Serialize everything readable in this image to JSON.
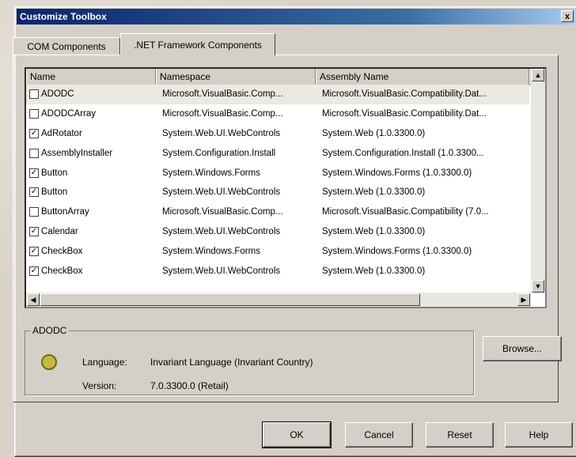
{
  "window": {
    "title": "Customize Toolbox",
    "close": "x"
  },
  "tabs": [
    {
      "label": "COM Components"
    },
    {
      "label": ".NET Framework Components"
    }
  ],
  "list": {
    "columns": [
      "Name",
      "Namespace",
      "Assembly Name"
    ],
    "rows": [
      {
        "checked": false,
        "name": "ADODC",
        "namespace": "Microsoft.VisualBasic.Comp...",
        "assembly": "Microsoft.VisualBasic.Compatibility.Dat..."
      },
      {
        "checked": false,
        "name": "ADODCArray",
        "namespace": "Microsoft.VisualBasic.Comp...",
        "assembly": "Microsoft.VisualBasic.Compatibility.Dat..."
      },
      {
        "checked": true,
        "name": "AdRotator",
        "namespace": "System.Web.UI.WebControls",
        "assembly": "System.Web (1.0.3300.0)"
      },
      {
        "checked": false,
        "name": "AssemblyInstaller",
        "namespace": "System.Configuration.Install",
        "assembly": "System.Configuration.Install (1.0.3300..."
      },
      {
        "checked": true,
        "name": "Button",
        "namespace": "System.Windows.Forms",
        "assembly": "System.Windows.Forms (1.0.3300.0)"
      },
      {
        "checked": true,
        "name": "Button",
        "namespace": "System.Web.UI.WebControls",
        "assembly": "System.Web (1.0.3300.0)"
      },
      {
        "checked": false,
        "name": "ButtonArray",
        "namespace": "Microsoft.VisualBasic.Comp...",
        "assembly": "Microsoft.VisualBasic.Compatibility (7.0..."
      },
      {
        "checked": true,
        "name": "Calendar",
        "namespace": "System.Web.UI.WebControls",
        "assembly": "System.Web (1.0.3300.0)"
      },
      {
        "checked": true,
        "name": "CheckBox",
        "namespace": "System.Windows.Forms",
        "assembly": "System.Windows.Forms (1.0.3300.0)"
      },
      {
        "checked": true,
        "name": "CheckBox",
        "namespace": "System.Web.UI.WebControls",
        "assembly": "System.Web (1.0.3300.0)"
      }
    ]
  },
  "details": {
    "group_title": "ADODC",
    "language_label": "Language:",
    "language_value": "Invariant Language (Invariant Country)",
    "version_label": "Version:",
    "version_value": "7.0.3300.0 (Retail)"
  },
  "buttons": {
    "browse": "Browse...",
    "ok": "OK",
    "cancel": "Cancel",
    "reset": "Reset",
    "help": "Help"
  },
  "icons": {
    "component": "gear-icon",
    "checkmark": "check-icon"
  }
}
